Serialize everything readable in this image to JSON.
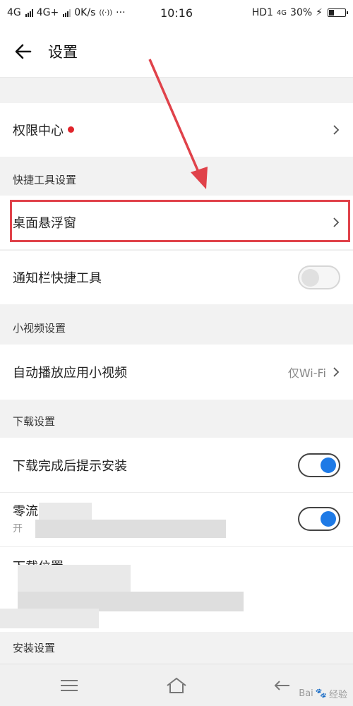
{
  "status_bar": {
    "signal1": "4G",
    "signal2": "4G+",
    "speed": "0K/s",
    "time": "10:16",
    "hd": "HD1",
    "net": "4G",
    "battery": "30%",
    "battery_level": 0.3
  },
  "app_bar": {
    "title": "设置"
  },
  "rows": {
    "permissions": {
      "label": "权限中心"
    },
    "desktop_float": {
      "label": "桌面悬浮窗"
    },
    "notification_tools": {
      "label": "通知栏快捷工具",
      "toggle": "off"
    },
    "autoplay": {
      "label": "自动播放应用小视频",
      "value": "仅Wi-Fi"
    },
    "prompt_install": {
      "label": "下载完成后提示安装",
      "toggle": "on"
    },
    "zero_traffic": {
      "label": "零流",
      "sub": "开",
      "toggle": "on"
    },
    "download_location": {
      "label": "下载位置"
    }
  },
  "sections": {
    "shortcut_tools": "快捷工具设置",
    "mini_video": "小视频设置",
    "download": "下载设置",
    "install": "安装设置"
  },
  "watermark": {
    "text": "经验",
    "brand": "Bai"
  },
  "colors": {
    "accent": "#1e7ae6",
    "annotation": "#e0424a",
    "badge": "#e0242b"
  }
}
